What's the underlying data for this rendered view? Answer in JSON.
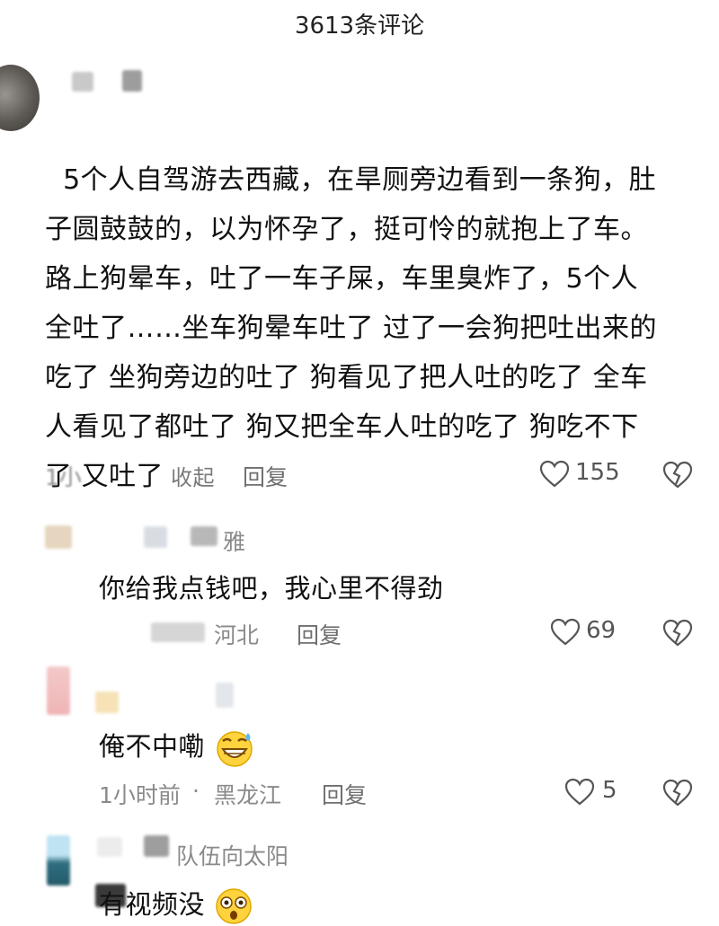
{
  "header": {
    "title": "3613条评论"
  },
  "comments": [
    {
      "username": "",
      "text": "5个人自驾游去西藏，在旱厕旁边看到一条狗，肚\n子圆鼓鼓的，以为怀孕了，挺可怜的就抱上了车。\n路上狗晕车，吐了一车子屎，车里臭炸了，5个人\n全吐了……坐车狗晕车吐了 过了一会狗把吐出来的\n吃了 坐狗旁边的吐了 狗看见了把人吐的吃了 全车\n人看见了都吐了 狗又把全车人吐的吃了 狗吃不下\n了 又吐了",
      "collapse_label": "收起",
      "time": "1小",
      "reply_label": "回复",
      "likes": "155"
    }
  ],
  "replies": [
    {
      "username": "雅",
      "text": "你给我点钱吧，我心里不得劲",
      "location": "河北",
      "reply_label": "回复",
      "likes": "69"
    },
    {
      "username": "",
      "text": "俺不中嘞",
      "time": "1小时前",
      "dot": "·",
      "location": "黑龙江",
      "reply_label": "回复",
      "likes": "5"
    },
    {
      "username": "队伍向太阳",
      "text": "有视频没"
    }
  ],
  "colors": {
    "muted": "#8a8a8a",
    "text": "#111111"
  },
  "icons": [
    "heart-outline-icon",
    "broken-heart-icon",
    "grin-sweat-emoji-icon",
    "astonished-emoji-icon"
  ]
}
